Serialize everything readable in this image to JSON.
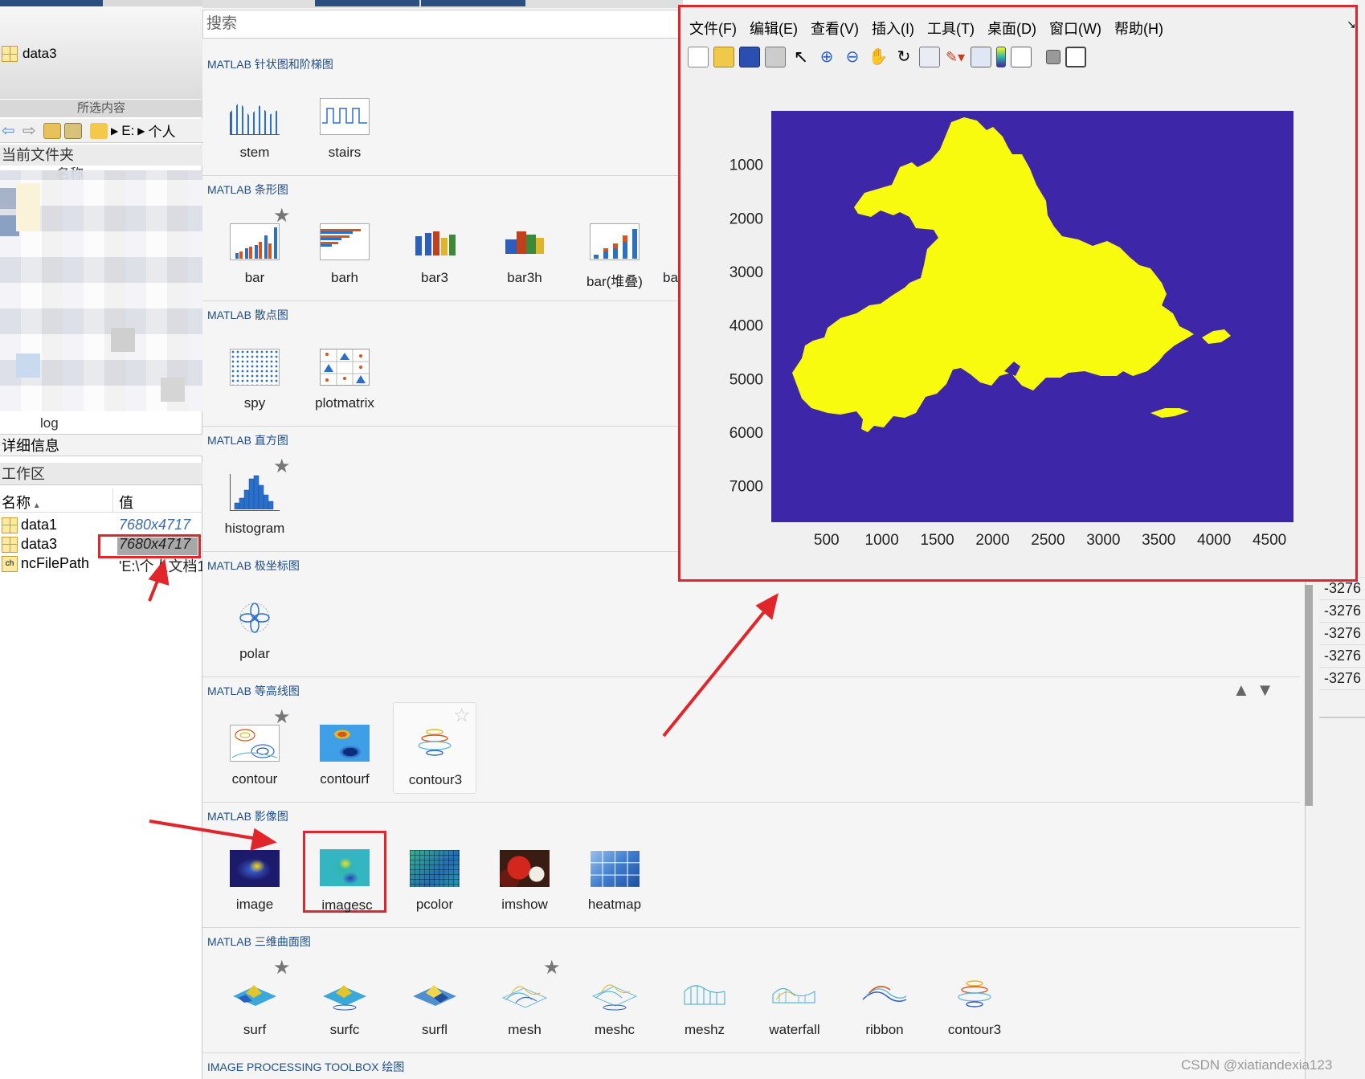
{
  "left_panel": {
    "selected_item": "data3",
    "selected_footer": "所选内容",
    "address": [
      "E:",
      "个人"
    ],
    "current_folder": "当前文件夹",
    "filelist_header": "名称",
    "filelist_last": "log",
    "details": "详细信息",
    "workspace": "工作区",
    "columns": {
      "name": "名称",
      "value": "值"
    },
    "variables": [
      {
        "name": "data1",
        "value": "7680x4717"
      },
      {
        "name": "data3",
        "value": "7680x4717"
      },
      {
        "name": "ncFilePath",
        "value": "'E:\\个人文档1"
      }
    ]
  },
  "gallery": {
    "search_placeholder": "搜索",
    "sections": [
      {
        "title": "MATLAB 针状图和阶梯图",
        "items": [
          "stem",
          "stairs"
        ]
      },
      {
        "title": "MATLAB 条形图",
        "items": [
          "bar",
          "barh",
          "bar3",
          "bar3h",
          "bar(堆叠)",
          "ba"
        ]
      },
      {
        "title": "MATLAB 散点图",
        "items": [
          "spy",
          "plotmatrix"
        ]
      },
      {
        "title": "MATLAB 直方图",
        "items": [
          "histogram"
        ]
      },
      {
        "title": "MATLAB 极坐标图",
        "items": [
          "polar"
        ]
      },
      {
        "title": "MATLAB 等高线图",
        "items": [
          "contour",
          "contourf",
          "contour3"
        ]
      },
      {
        "title": "MATLAB 影像图",
        "items": [
          "image",
          "imagesc",
          "pcolor",
          "imshow",
          "heatmap"
        ]
      },
      {
        "title": "MATLAB 三维曲面图",
        "items": [
          "surf",
          "surfc",
          "surfl",
          "mesh",
          "meshc",
          "meshz",
          "waterfall",
          "ribbon",
          "contour3"
        ]
      },
      {
        "title": "IMAGE PROCESSING TOOLBOX 绘图",
        "items": []
      }
    ]
  },
  "figure": {
    "menu": [
      "文件(F)",
      "编辑(E)",
      "查看(V)",
      "插入(I)",
      "工具(T)",
      "桌面(D)",
      "窗口(W)",
      "帮助(H)"
    ],
    "chart_data": {
      "type": "heatmap",
      "yticks": [
        1000,
        2000,
        3000,
        4000,
        5000,
        6000,
        7000
      ],
      "xticks": [
        500,
        1000,
        1500,
        2000,
        2500,
        3000,
        3500,
        4000,
        4500
      ],
      "xlim": [
        1,
        4717
      ],
      "ylim": [
        1,
        7680
      ],
      "colors": {
        "background": "#3e26a8",
        "region": "#f9fb0e"
      }
    }
  },
  "right_strip": {
    "values": [
      "-3276",
      "-3276",
      "-3276",
      "-3276",
      "-3276"
    ]
  },
  "watermark": "CSDN @xiatiandexia123"
}
